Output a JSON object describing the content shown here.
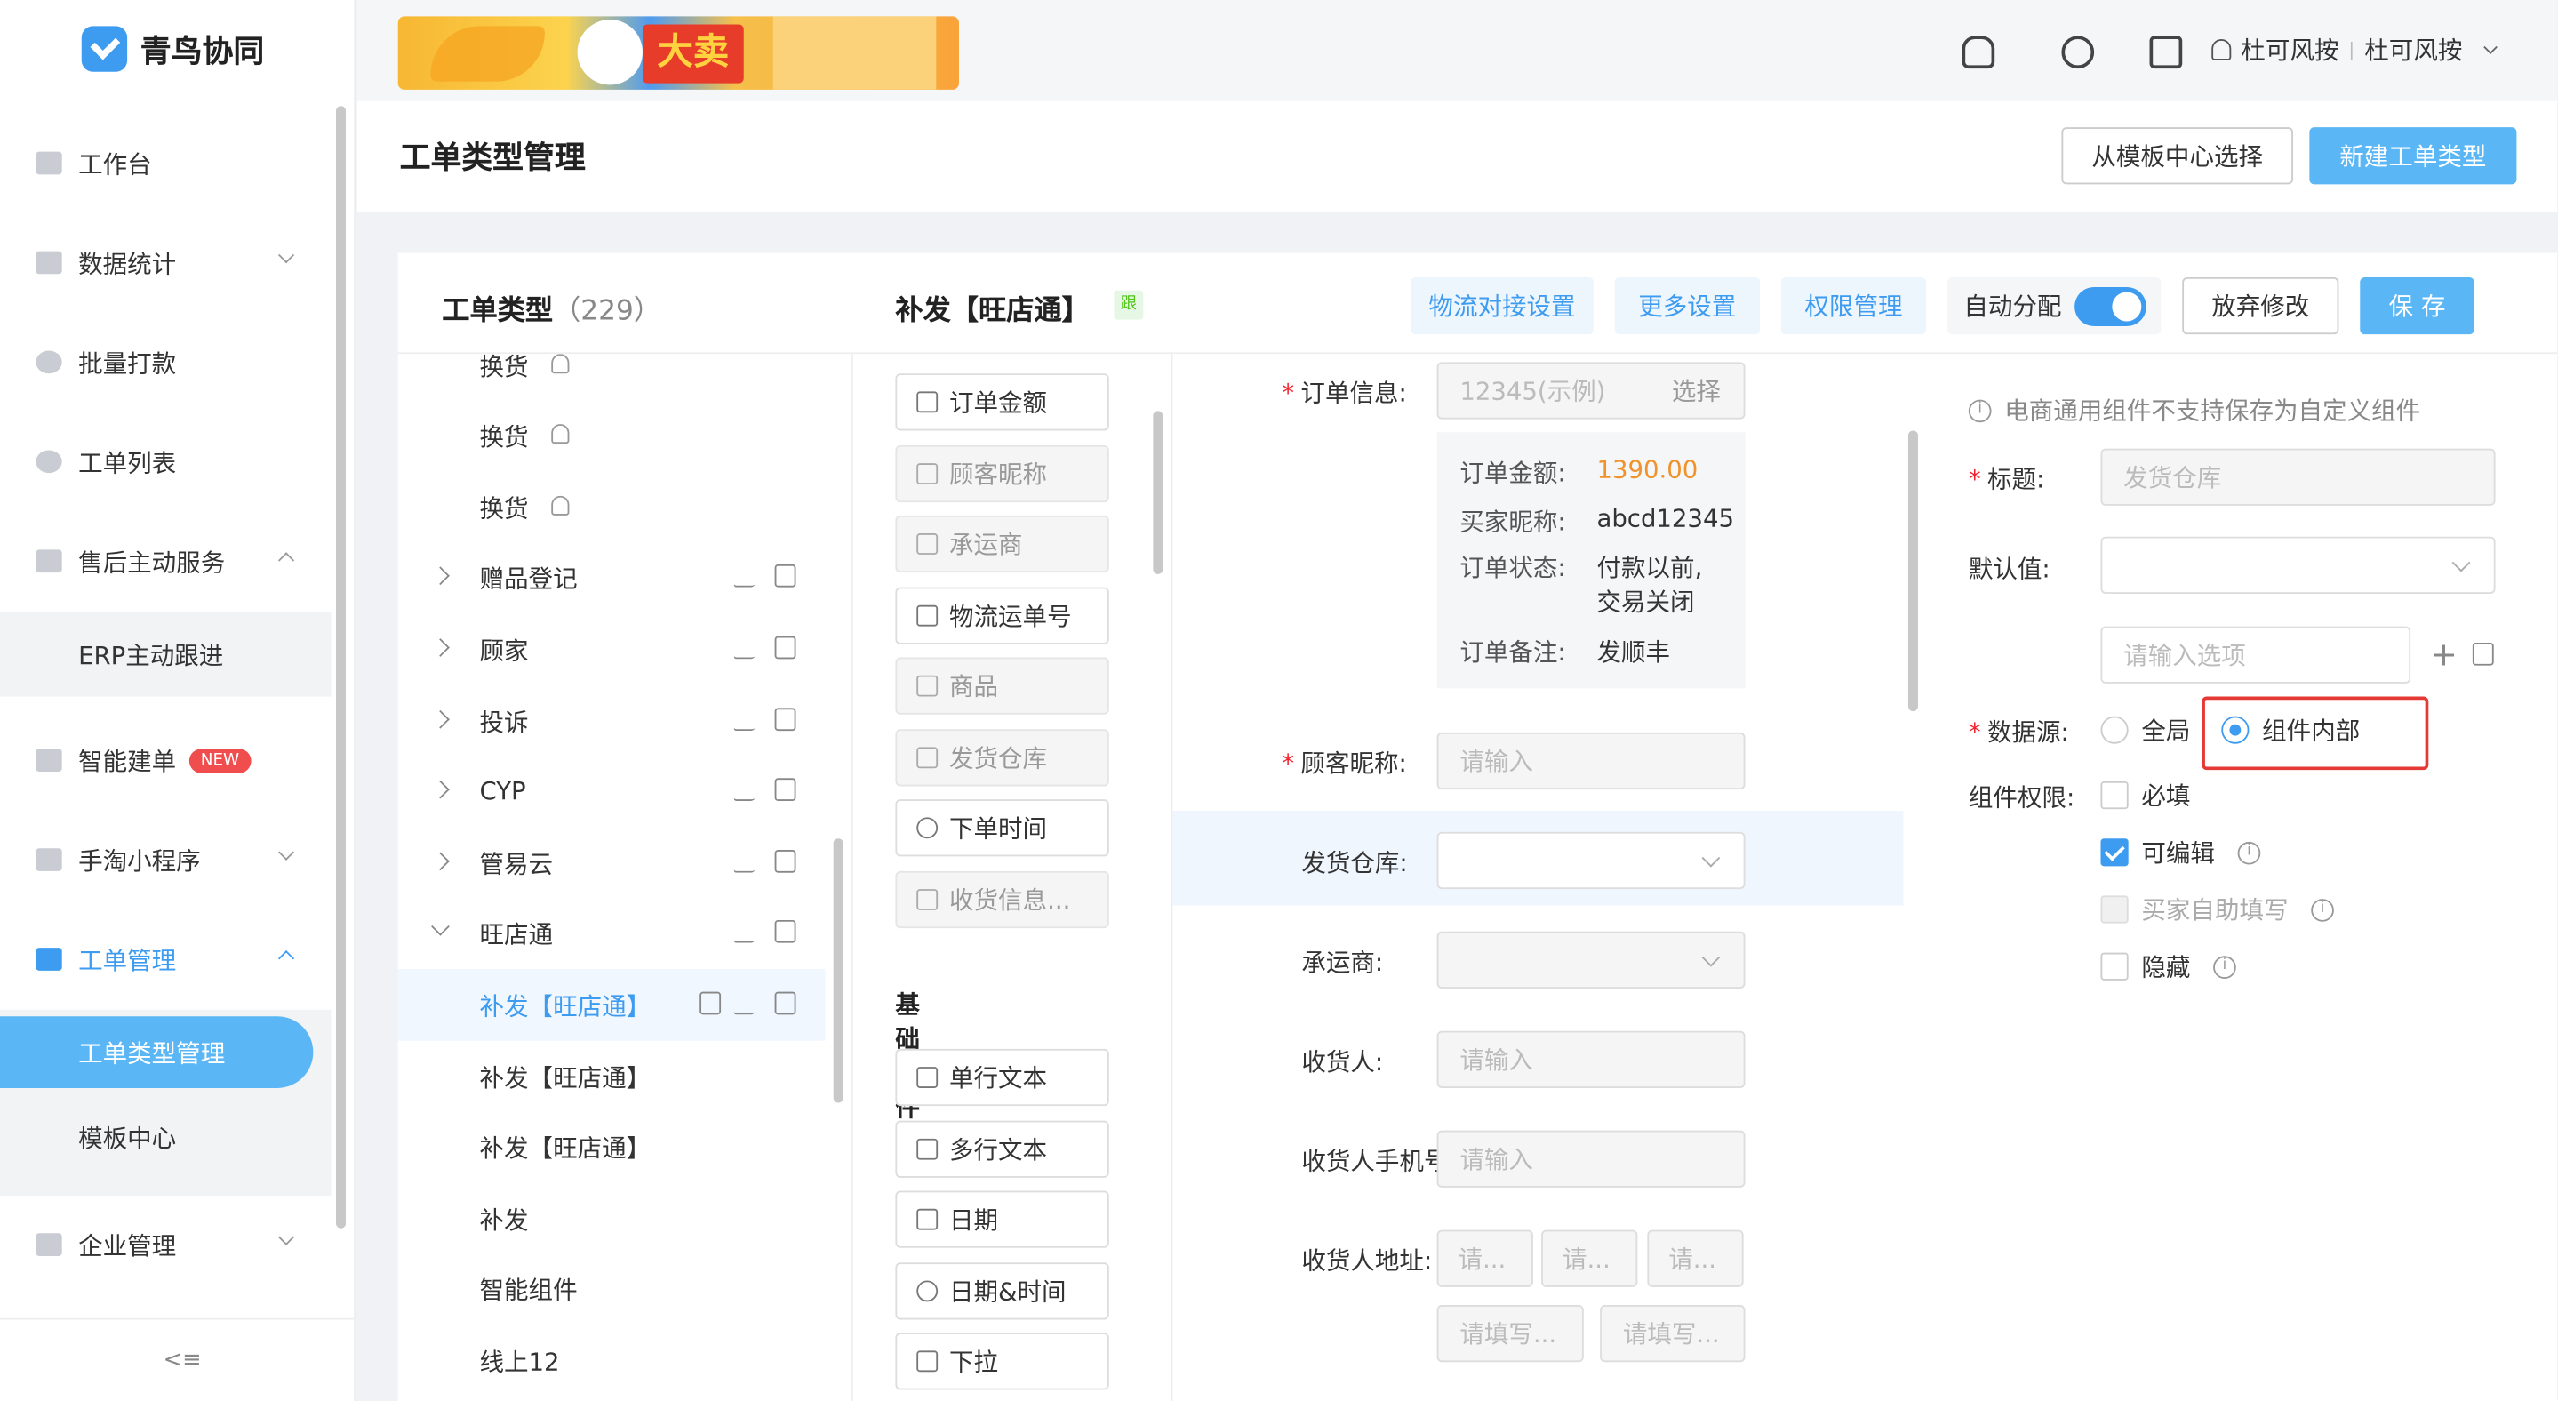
{
  "app": {
    "name": "青鸟协同"
  },
  "sidebar": {
    "items": [
      {
        "label": "工作台"
      },
      {
        "label": "数据统计"
      },
      {
        "label": "批量打款"
      },
      {
        "label": "工单列表"
      },
      {
        "label": "售后主动服务"
      },
      {
        "label": "智能建单",
        "badge": "NEW"
      },
      {
        "label": "手淘小程序"
      },
      {
        "label": "工单管理"
      },
      {
        "label": "企业管理"
      }
    ],
    "aftersale_sub": [
      "ERP主动跟进"
    ],
    "ticket_sub": [
      "工单类型管理",
      "模板中心"
    ]
  },
  "topbar": {
    "banner_text": "大卖",
    "user": "杜可风按",
    "company": "杜可风按",
    "separator": "|"
  },
  "header": {
    "title": "工单类型管理",
    "btn_template": "从模板中心选择",
    "btn_new": "新建工单类型"
  },
  "types_panel": {
    "title": "工单类型",
    "count": "（229）"
  },
  "tree": [
    {
      "label": "换货",
      "owner": true
    },
    {
      "label": "换货",
      "owner": true
    },
    {
      "label": "换货",
      "owner": true
    },
    {
      "label": "赠品登记",
      "expand": "closed",
      "ops": true
    },
    {
      "label": "顾家",
      "expand": "closed",
      "ops": true
    },
    {
      "label": "投诉",
      "expand": "closed",
      "ops": true
    },
    {
      "label": "CYP",
      "expand": "closed",
      "ops": true
    },
    {
      "label": "管易云",
      "expand": "closed",
      "ops": true
    },
    {
      "label": "旺店通",
      "expand": "open",
      "ops": true
    },
    {
      "label": "补发【旺店通】",
      "selected": true
    },
    {
      "label": "补发【旺店通】"
    },
    {
      "label": "补发【旺店通】"
    },
    {
      "label": "补发"
    },
    {
      "label": "智能组件"
    },
    {
      "label": "线上12"
    }
  ],
  "editor": {
    "title": "补发【旺店通】",
    "tag": "跟",
    "btn_logistics": "物流对接设置",
    "btn_more": "更多设置",
    "btn_perm": "权限管理",
    "auto_assign": "自动分配",
    "btn_discard": "放弃修改",
    "btn_save": "保 存"
  },
  "components": {
    "ecommerce": [
      {
        "label": "订单金额",
        "disabled": false
      },
      {
        "label": "顾客昵称",
        "disabled": true
      },
      {
        "label": "承运商",
        "disabled": true
      },
      {
        "label": "物流运单号",
        "disabled": false
      },
      {
        "label": "商品",
        "disabled": true
      },
      {
        "label": "发货仓库",
        "disabled": true
      },
      {
        "label": "下单时间",
        "disabled": false
      },
      {
        "label": "收货信息...",
        "disabled": true
      }
    ],
    "basic_title": "基础组件",
    "basic": [
      {
        "label": "单行文本"
      },
      {
        "label": "多行文本"
      },
      {
        "label": "日期"
      },
      {
        "label": "日期&时间"
      },
      {
        "label": "下拉"
      }
    ]
  },
  "form": {
    "order_info_label": "订单信息:",
    "order_input": "12345(示例)",
    "order_select": "选择",
    "order_details": [
      {
        "k": "订单金额:",
        "v": "1390.00"
      },
      {
        "k": "买家昵称:",
        "v": "abcd12345"
      },
      {
        "k": "订单状态:",
        "v": "付款以前,",
        "v2": "交易关闭"
      },
      {
        "k": "订单备注:",
        "v": "发顺丰"
      }
    ],
    "customer_label": "顾客昵称:",
    "warehouse_label": "发货仓库:",
    "carrier_label": "承运商:",
    "receiver_label": "收货人:",
    "phone_label": "收货人手机号",
    "address_label": "收货人地址:",
    "placeholder": "请输入",
    "addr_short": "请...",
    "addr_detail": "请填写..."
  },
  "props": {
    "note": "电商通用组件不支持保存为自定义组件",
    "title_label": "标题:",
    "title_value": "发货仓库",
    "default_label": "默认值:",
    "option_placeholder": "请输入选项",
    "datasource_label": "数据源:",
    "ds_global": "全局",
    "ds_internal": "组件内部",
    "perm_label": "组件权限:",
    "perm_required": "必填",
    "perm_editable": "可编辑",
    "perm_buyer": "买家自助填写",
    "perm_hidden": "隐藏"
  },
  "colors": {
    "primary": "#3d9bf0",
    "button": "#5ab6f5",
    "highlight": "#e53935",
    "amount": "#f0932b"
  }
}
